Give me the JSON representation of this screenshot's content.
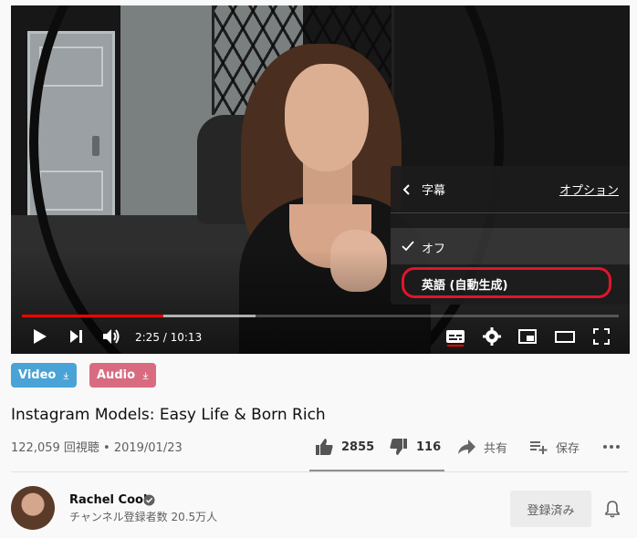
{
  "player": {
    "current_time": "2:25",
    "duration": "10:13",
    "time_display": "2:25 / 10:13",
    "played_fraction": 0.237,
    "buffered_fraction": 0.392,
    "progress_color": "#ff0000"
  },
  "settings_menu": {
    "title": "字幕",
    "options_link": "オプション",
    "items": [
      {
        "label": "オフ",
        "selected": true
      },
      {
        "label": "英語 (自動生成)",
        "selected": false,
        "highlighted": true
      }
    ],
    "highlight_color": "#e0152b"
  },
  "downloads": {
    "video_label": "Video",
    "audio_label": "Audio",
    "video_color": "#4aa3d6",
    "audio_color": "#d96b80"
  },
  "video": {
    "title": "Instagram Models: Easy Life & Born Rich",
    "meta": "122,059 回視聴 • 2019/01/23"
  },
  "actions": {
    "like_count": "2855",
    "dislike_count": "116",
    "share_label": "共有",
    "save_label": "保存"
  },
  "channel": {
    "name": "Rachel Cook",
    "subscribers": "チャンネル登録者数 20.5万人",
    "subscribe_button": "登録済み"
  },
  "icons": [
    "play-icon",
    "next-icon",
    "volume-icon",
    "subtitles-icon",
    "settings-icon",
    "miniplayer-icon",
    "theater-icon",
    "fullscreen-icon",
    "back-chevron-icon",
    "check-icon",
    "download-icon",
    "thumbs-up-icon",
    "thumbs-down-icon",
    "share-icon",
    "playlist-add-icon",
    "more-icon",
    "verified-icon",
    "bell-icon"
  ]
}
